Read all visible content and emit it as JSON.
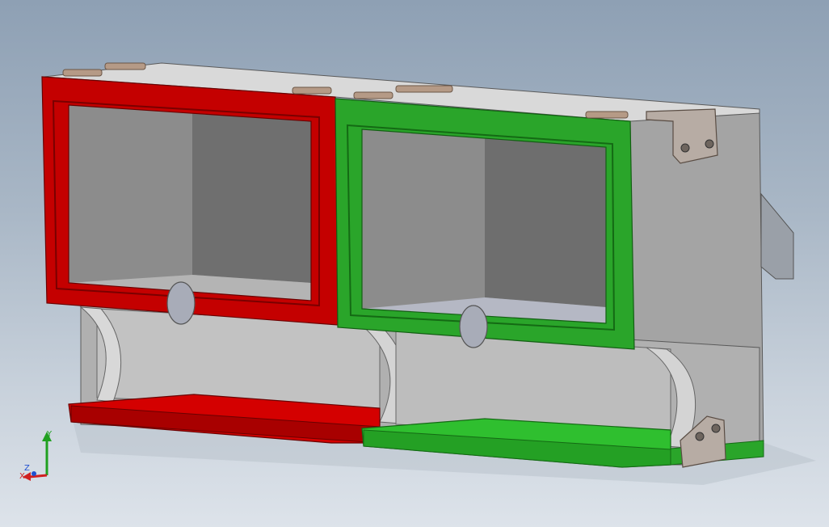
{
  "viewport": {
    "background_top": "#8ea0b4",
    "background_bottom": "#dde3ea"
  },
  "model": {
    "body_color": "#c8c8c8",
    "body_dark": "#9e9e9e",
    "interior_color": "#8a8a8a",
    "left_door_color": "#c40000",
    "left_door_dark": "#8e0000",
    "right_door_color": "#2aa52a",
    "right_door_dark": "#1e7d1e",
    "hinge_color": "#b59a86",
    "bracket_color": "#b7aca4",
    "knob_color": "#a8acb8"
  },
  "triad": {
    "x_label": "X",
    "y_label": "Y",
    "z_label": "Z",
    "x_color": "#d02020",
    "y_color": "#20a020",
    "z_color": "#2050d0"
  }
}
